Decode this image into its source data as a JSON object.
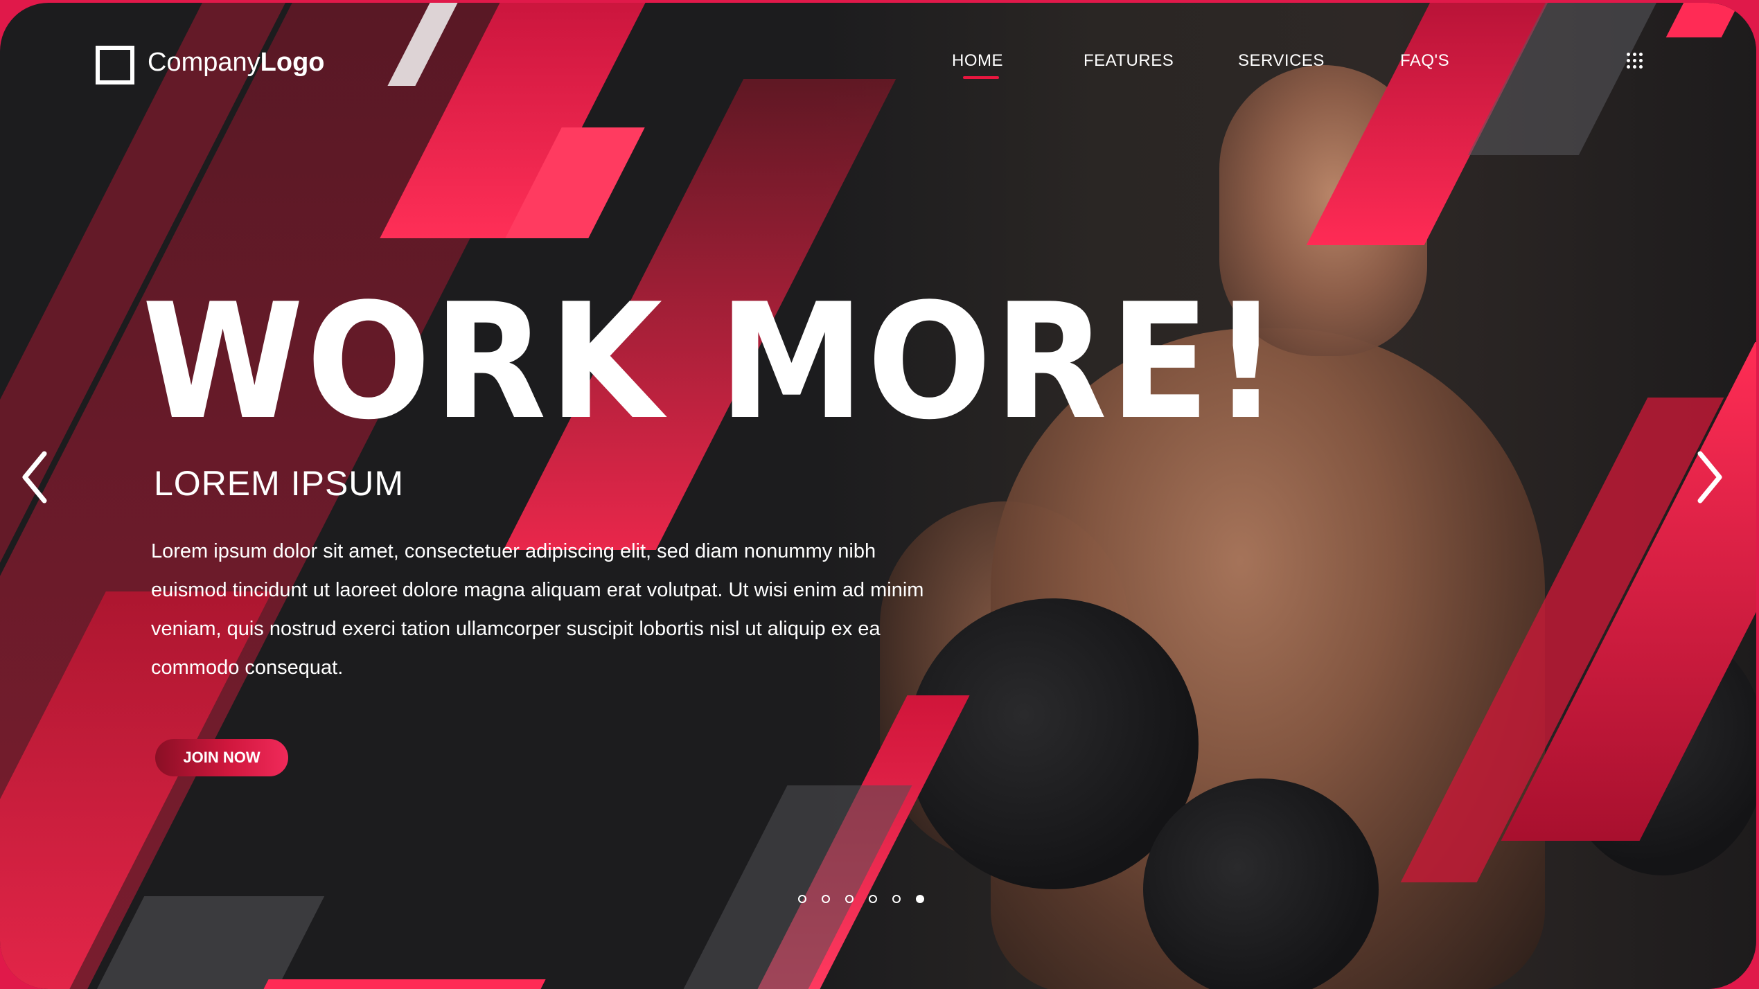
{
  "brand": {
    "logo_regular": "Company",
    "logo_bold": "Logo"
  },
  "nav": {
    "items": [
      {
        "label": "HOME",
        "active": true
      },
      {
        "label": "FEATURES",
        "active": false
      },
      {
        "label": "SERVICES",
        "active": false
      },
      {
        "label": "FAQ'S",
        "active": false
      }
    ],
    "menu_icon": "grid-dots-icon"
  },
  "hero": {
    "headline": "WORK MORE!",
    "subhead": "LOREM IPSUM",
    "body": "Lorem ipsum dolor sit amet, consectetuer adipiscing elit, sed diam nonummy nibh euismod tincidunt ut laoreet dolore magna aliquam erat volutpat. Ut wisi enim ad minim veniam, quis nostrud exerci tation ullamcorper suscipit lobortis nisl ut aliquip ex ea commodo consequat.",
    "cta_label": "JOIN NOW"
  },
  "carousel": {
    "prev_icon": "chevron-left-icon",
    "next_icon": "chevron-right-icon",
    "slide_count": 6,
    "active_index": 5
  },
  "colors": {
    "accent": "#e8173f",
    "background": "#1c1c1e",
    "frame": "#e0194a",
    "text": "#ffffff"
  }
}
